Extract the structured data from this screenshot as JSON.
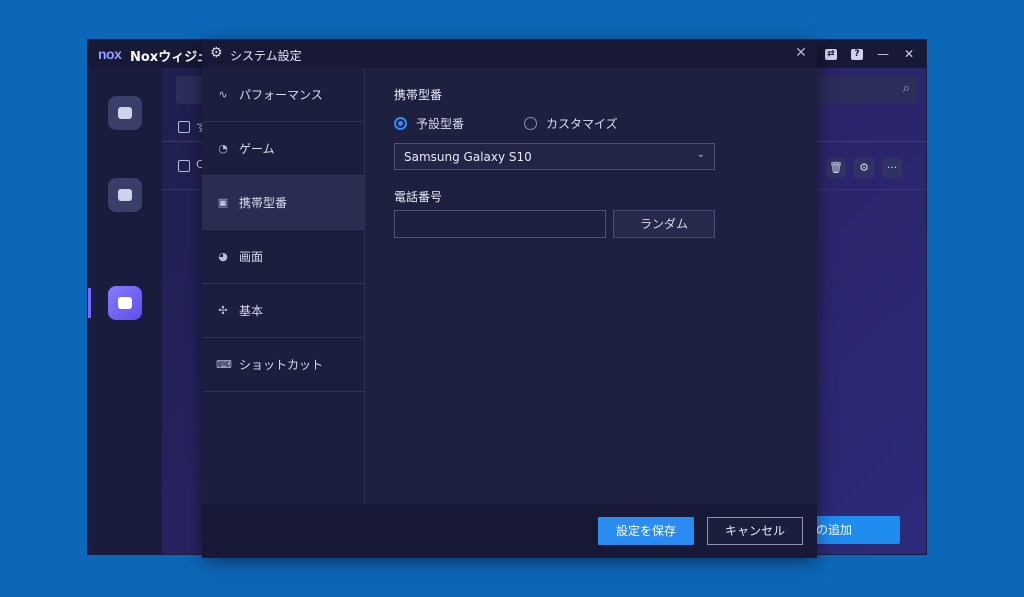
{
  "background_app": {
    "logo": "nox",
    "title": "Noxウィジュ",
    "controls": [
      "window-icon",
      "question-icon",
      "minimize-icon",
      "close-icon"
    ],
    "sidebar": [
      "app-folder-icon",
      "app-store-icon",
      "multi-instance-icon"
    ],
    "row_checkbox_partial_text": "C",
    "header_checkbox_partial_text": "す",
    "bottom_button_partial_label": "の追加"
  },
  "dialog": {
    "title": "システム設定",
    "nav": [
      {
        "label": "パフォーマンス",
        "icon": "pulse-icon"
      },
      {
        "label": "ゲーム",
        "icon": "gamepad-icon"
      },
      {
        "label": "携帯型番",
        "icon": "phone-icon"
      },
      {
        "label": "画面",
        "icon": "palette-icon"
      },
      {
        "label": "基本",
        "icon": "puzzle-icon"
      },
      {
        "label": "ショットカット",
        "icon": "keyboard-icon"
      }
    ],
    "active_nav": "携帯型番",
    "content": {
      "model_section_label": "携帯型番",
      "radio_preset_label": "予設型番",
      "radio_custom_label": "カスタマイズ",
      "selected_radio": "予設型番",
      "model_select_value": "Samsung Galaxy S10",
      "phone_section_label": "電話番号",
      "phone_value": "",
      "random_button_label": "ランダム"
    },
    "footer": {
      "save_label": "設定を保存",
      "cancel_label": "キャンセル"
    }
  },
  "colors": {
    "desktop": "#0d67b8",
    "accent": "#2a8cf0",
    "dialog_bg": "#1e2040"
  }
}
